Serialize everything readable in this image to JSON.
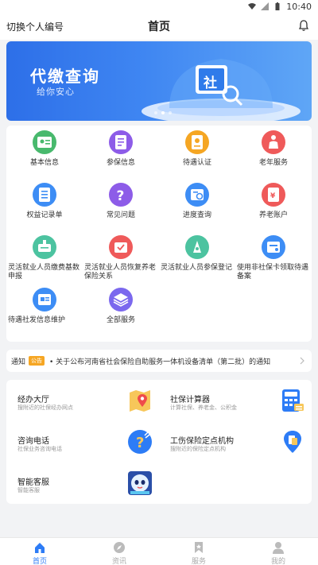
{
  "status_bar": {
    "time": "10:40"
  },
  "header": {
    "switch_label": "切换个人编号",
    "title": "首页"
  },
  "banner": {
    "title": "代缴查询",
    "subtitle": "给你安心",
    "logo_char": "社",
    "page_count": 3,
    "active_page": 1
  },
  "grid": {
    "items": [
      {
        "label": "基本信息",
        "icon": "id-card-icon",
        "color": "#48b96d"
      },
      {
        "label": "参保信息",
        "icon": "insurance-doc-icon",
        "color": "#8d5ce8"
      },
      {
        "label": "待遇认证",
        "icon": "certify-icon",
        "color": "#f5a623"
      },
      {
        "label": "老年服务",
        "icon": "elderly-icon",
        "color": "#ef5a5a"
      },
      {
        "label": "权益记录单",
        "icon": "record-icon",
        "color": "#3d8df5"
      },
      {
        "label": "常见问题",
        "icon": "question-icon",
        "color": "#8d5ce8"
      },
      {
        "label": "进度查询",
        "icon": "progress-icon",
        "color": "#3d8df5"
      },
      {
        "label": "养老账户",
        "icon": "pension-account-icon",
        "color": "#ef5a5a"
      },
      {
        "label": "灵活就业人员缴费基数申报",
        "icon": "declare-icon",
        "color": "#4cc3a0"
      },
      {
        "label": "灵活就业人员恢复养老保险关系",
        "icon": "restore-icon",
        "color": "#ef5a5a"
      },
      {
        "label": "灵活就业人员参保登记",
        "icon": "register-icon",
        "color": "#4cc3a0"
      },
      {
        "label": "使用非社保卡领取待遇备案",
        "icon": "card-icon",
        "color": "#3d8df5"
      },
      {
        "label": "待遇社发信息维护",
        "icon": "maintain-icon",
        "color": "#3d8df5"
      },
      {
        "label": "全部服务",
        "icon": "layers-icon",
        "color": "#7b68ee"
      }
    ]
  },
  "notice": {
    "label": "通知",
    "badge": "公告",
    "text": "• 关于公布河南省社会保险自助服务一体机设备清单（第二批）的通知"
  },
  "services": {
    "items": [
      {
        "title": "经办大厅",
        "subtitle": "搜附近的社保经办网点",
        "icon": "map-pin-icon"
      },
      {
        "title": "社保计算器",
        "subtitle": "计算社保、养老金、公积金",
        "icon": "calculator-icon"
      },
      {
        "title": "咨询电话",
        "subtitle": "社保业务咨询电话",
        "icon": "phone-icon"
      },
      {
        "title": "工伤保险定点机构",
        "subtitle": "搜附近的保险定点机构",
        "icon": "institution-icon"
      },
      {
        "title": "智能客服",
        "subtitle": "智能客服",
        "icon": "robot-icon"
      }
    ]
  },
  "tabbar": {
    "items": [
      {
        "label": "首页",
        "icon": "home-icon",
        "active": true
      },
      {
        "label": "资讯",
        "icon": "compass-icon",
        "active": false
      },
      {
        "label": "服务",
        "icon": "bookmark-icon",
        "active": false
      },
      {
        "label": "我的",
        "icon": "user-icon",
        "active": false
      }
    ]
  },
  "colors": {
    "accent": "#2d7cf6",
    "banner": "#3f86f2"
  }
}
